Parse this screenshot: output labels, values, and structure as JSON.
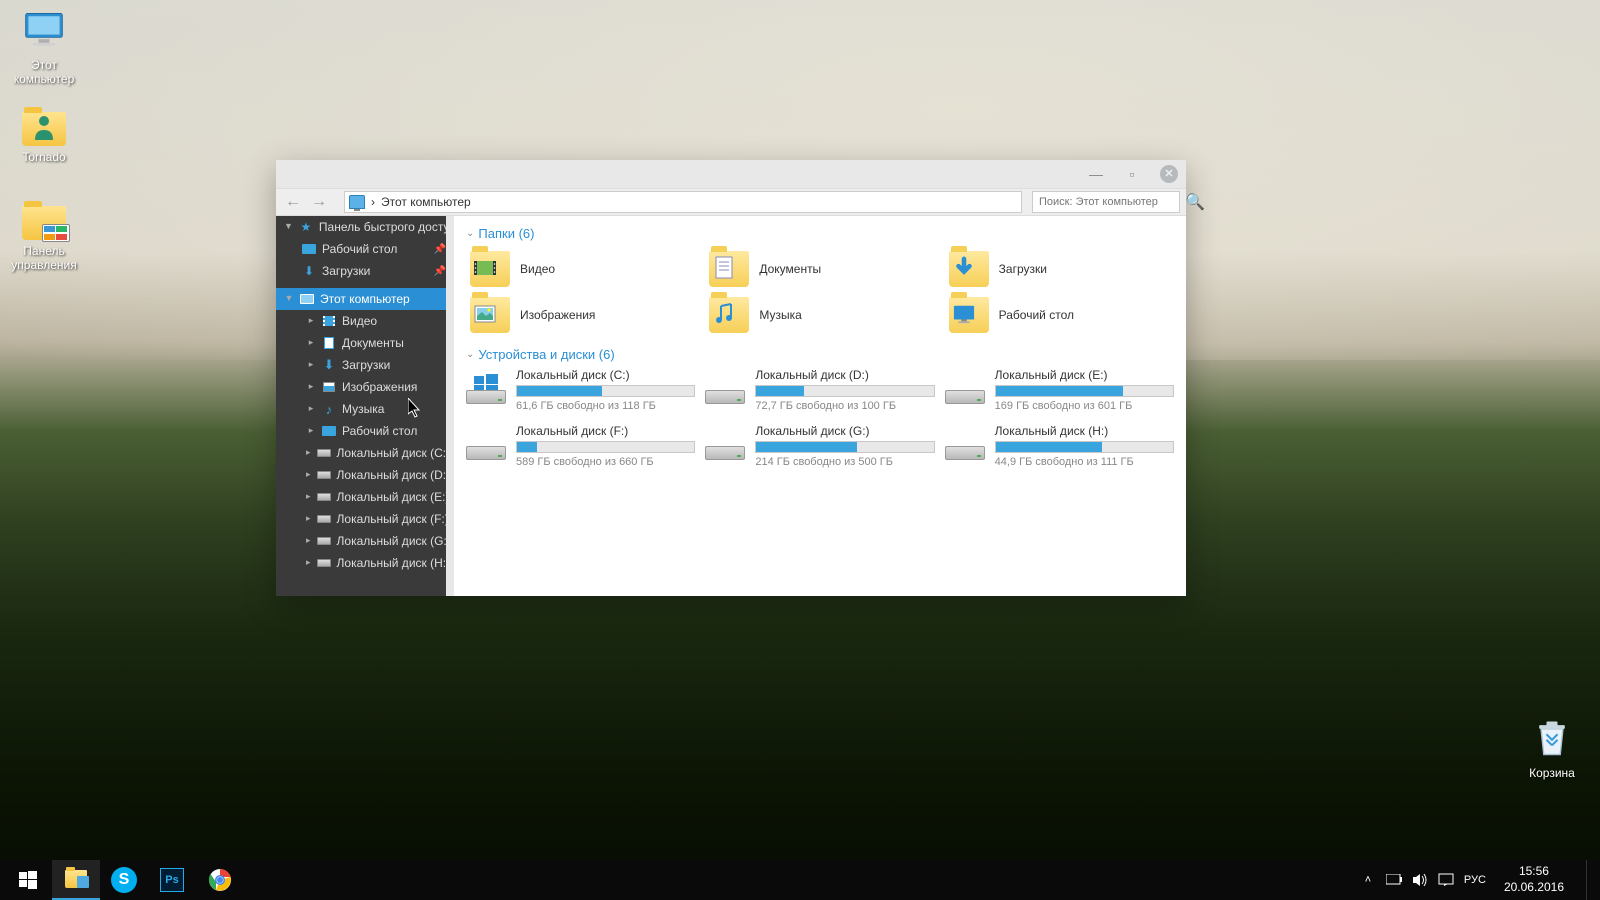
{
  "desktop": {
    "icons": [
      {
        "label": "Этот\nкомпьютер"
      },
      {
        "label": "Tornado"
      },
      {
        "label": "Панель\nуправления"
      },
      {
        "label": "Корзина"
      }
    ]
  },
  "window": {
    "address": "Этот компьютер",
    "address_sep": "›",
    "search_placeholder": "Поиск: Этот компьютер"
  },
  "sidebar": {
    "quick_access": "Панель быстрого доступа",
    "qa_items": [
      "Рабочий стол",
      "Загрузки"
    ],
    "this_pc": "Этот компьютер",
    "pc_items": [
      "Видео",
      "Документы",
      "Загрузки",
      "Изображения",
      "Музыка",
      "Рабочий стол",
      "Локальный диск (C:)",
      "Локальный диск (D:)",
      "Локальный диск (E:)",
      "Локальный диск (F:)",
      "Локальный диск (G:)",
      "Локальный диск (H:)"
    ]
  },
  "sections": {
    "folders_hdr": "Папки (6)",
    "drives_hdr": "Устройства и диски (6)"
  },
  "folders": [
    {
      "name": "Видео"
    },
    {
      "name": "Документы"
    },
    {
      "name": "Загрузки"
    },
    {
      "name": "Изображения"
    },
    {
      "name": "Музыка"
    },
    {
      "name": "Рабочий стол"
    }
  ],
  "drives": [
    {
      "name": "Локальный диск (C:)",
      "free": "61,6 ГБ свободно из 118 ГБ",
      "pct": 48,
      "system": true
    },
    {
      "name": "Локальный диск (D:)",
      "free": "72,7 ГБ свободно из 100 ГБ",
      "pct": 27
    },
    {
      "name": "Локальный диск (E:)",
      "free": "169 ГБ свободно из 601 ГБ",
      "pct": 72
    },
    {
      "name": "Локальный диск (F:)",
      "free": "589 ГБ свободно из 660 ГБ",
      "pct": 11
    },
    {
      "name": "Локальный диск (G:)",
      "free": "214 ГБ свободно из 500 ГБ",
      "pct": 57
    },
    {
      "name": "Локальный диск (H:)",
      "free": "44,9 ГБ свободно из 111 ГБ",
      "pct": 60
    }
  ],
  "taskbar": {
    "lang": "РУС",
    "time": "15:56",
    "date": "20.06.2016"
  }
}
